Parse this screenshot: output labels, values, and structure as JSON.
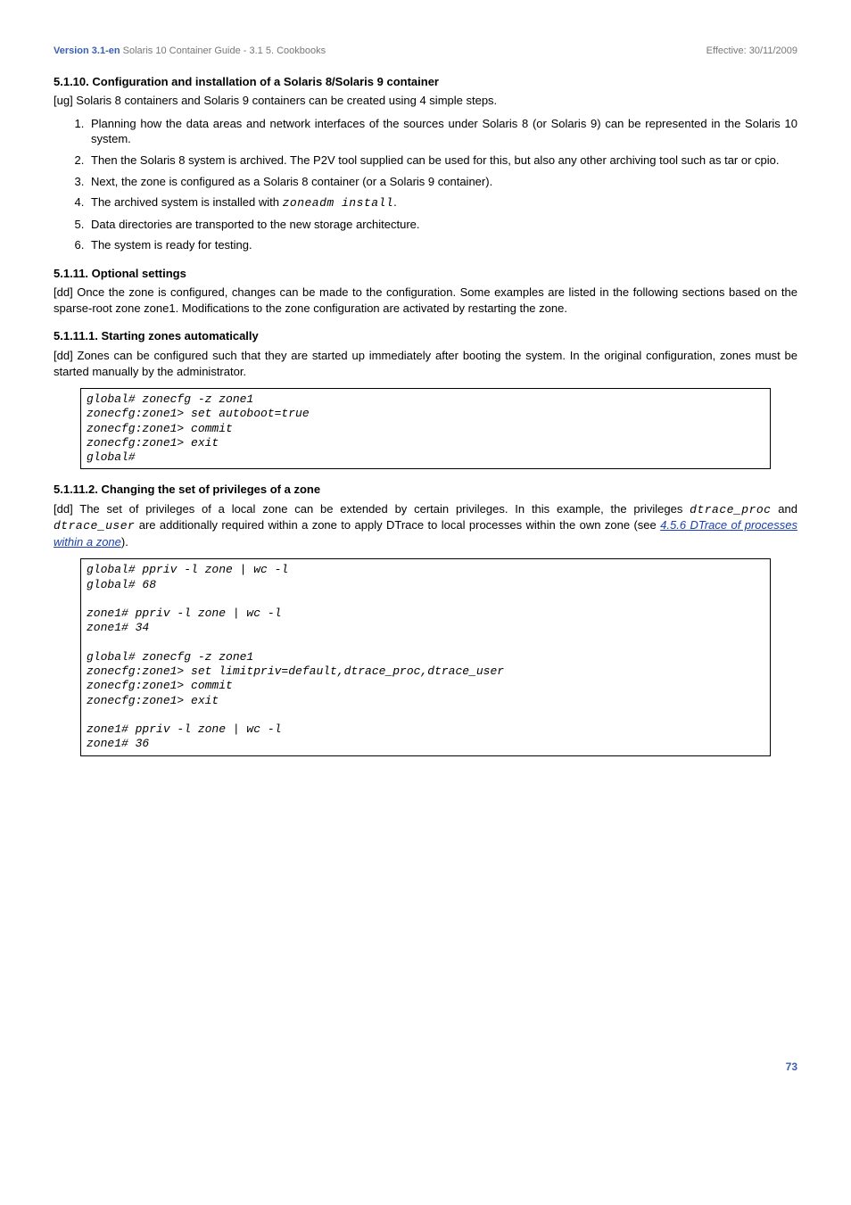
{
  "header": {
    "version": "Version 3.1-en",
    "breadcrumb": "Solaris 10 Container Guide - 3.1   5. Cookbooks",
    "effective": "Effective: 30/11/2009"
  },
  "s5110": {
    "heading": "5.1.10. Configuration and installation of a Solaris 8/Solaris 9 container",
    "intro": "[ug] Solaris 8 containers and Solaris 9 containers can be created using 4 simple steps.",
    "items": [
      "Planning how the data areas and network interfaces of the sources under Solaris 8 (or Solaris 9) can be represented in the Solaris 10 system.",
      "Then the Solaris 8 system is archived. The P2V tool supplied can be used for this, but also any other archiving tool such as tar or cpio.",
      "Next, the zone is configured as a Solaris 8 container (or a Solaris 9 container).",
      "The archived system is installed with ",
      "Data directories are transported to the new storage architecture.",
      "The system is ready for testing."
    ],
    "code4": "zoneadm install",
    "tail4": "."
  },
  "s5111": {
    "heading": "5.1.11. Optional settings",
    "para": "[dd] Once the zone is configured, changes can be made to the configuration. Some examples are listed in the following sections based on the sparse-root zone zone1. Modifications to the zone configuration are activated by restarting the zone."
  },
  "s51111": {
    "heading": "5.1.11.1. Starting zones automatically",
    "para": "[dd] Zones can be configured such that they are started up immediately after booting the system. In the original configuration, zones must be started manually by the administrator.",
    "code": "global# zonecfg -z zone1\nzonecfg:zone1> set autoboot=true\nzonecfg:zone1> commit\nzonecfg:zone1> exit\nglobal#"
  },
  "s51112": {
    "heading": "5.1.11.2. Changing the set of privileges of a zone",
    "para_a": "[dd] The set of privileges of a local zone can be extended by certain privileges. In this example, the privileges ",
    "code_a": "dtrace_proc",
    "mid": " and ",
    "code_b": "dtrace_user",
    "para_b": " are additionally required within a zone to apply DTrace to local processes within the own zone (see ",
    "link": "4.5.6 DTrace of processes within a zone",
    "para_c": ").",
    "code": "global# ppriv -l zone | wc -l\nglobal# 68\n\nzone1# ppriv -l zone | wc -l\nzone1# 34\n\nglobal# zonecfg -z zone1\nzonecfg:zone1> set limitpriv=default,dtrace_proc,dtrace_user\nzonecfg:zone1> commit\nzonecfg:zone1> exit\n\nzone1# ppriv -l zone | wc -l\nzone1# 36"
  },
  "pagenum": "73"
}
